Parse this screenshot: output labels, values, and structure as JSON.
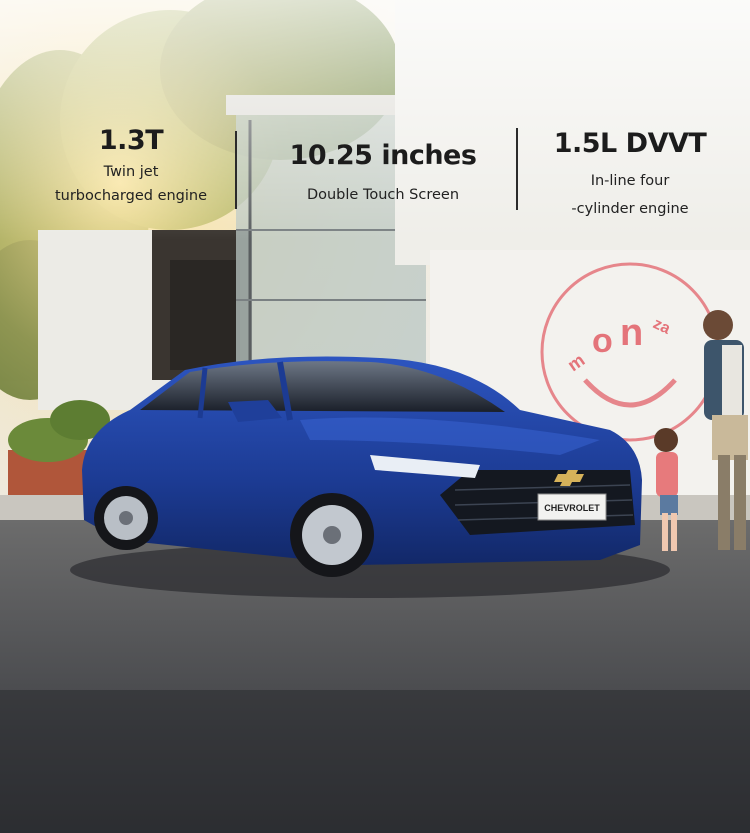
{
  "specs": [
    {
      "headline": "1.3T",
      "line1": "Twin jet",
      "line2": "turbocharged engine"
    },
    {
      "headline": "10.25 inches",
      "line1": "Double Touch Screen"
    },
    {
      "headline": "1.5L DVVT",
      "line1": "In-line four",
      "line2": "-cylinder engine"
    }
  ],
  "car": {
    "badge_text": "CHEVROLET",
    "body_color": "#1f3f9a"
  },
  "wall_logo": {
    "text": [
      "m",
      "o",
      "n",
      "za"
    ],
    "color": "#e4747a"
  }
}
